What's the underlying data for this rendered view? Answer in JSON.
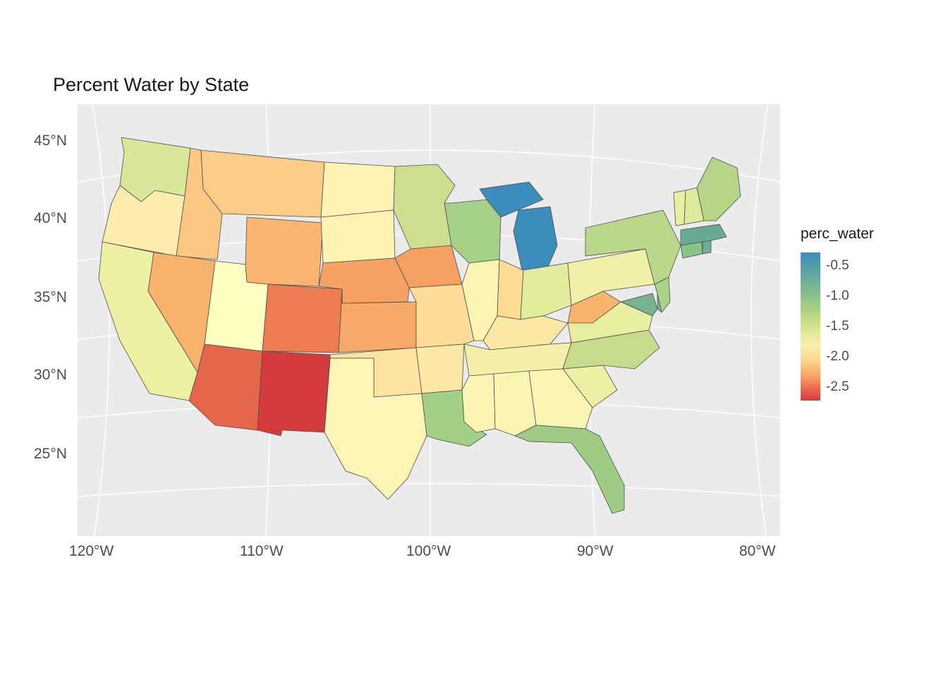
{
  "title": "Percent Water by State",
  "legend_title": "perc_water",
  "y_ticks": [
    "45°N",
    "40°N",
    "35°N",
    "30°N",
    "25°N"
  ],
  "x_ticks": [
    "120°W",
    "110°W",
    "100°W",
    "90°W",
    "80°W"
  ],
  "legend_labels": [
    "-0.5",
    "-1.0",
    "-1.5",
    "-2.0",
    "-2.5"
  ],
  "chart_data": {
    "type": "choropleth",
    "region": "US states (lower 48)",
    "title": "Percent Water by State",
    "color_scale": {
      "variable": "perc_water",
      "min": -2.7,
      "max": -0.3,
      "palette": "RdYlBu"
    },
    "xlabel": "",
    "ylabel": "",
    "x_range_deg": [
      -124,
      -67
    ],
    "y_range_deg": [
      23,
      49
    ],
    "states": [
      {
        "name": "Michigan",
        "perc_water": -0.3
      },
      {
        "name": "Massachusetts",
        "perc_water": -0.6
      },
      {
        "name": "Rhode Island",
        "perc_water": -0.6
      },
      {
        "name": "Maryland",
        "perc_water": -0.7
      },
      {
        "name": "Delaware",
        "perc_water": -0.7
      },
      {
        "name": "Florida",
        "perc_water": -0.9
      },
      {
        "name": "Louisiana",
        "perc_water": -0.9
      },
      {
        "name": "Wisconsin",
        "perc_water": -0.9
      },
      {
        "name": "New Jersey",
        "perc_water": -0.9
      },
      {
        "name": "Connecticut",
        "perc_water": -0.9
      },
      {
        "name": "Maine",
        "perc_water": -1.0
      },
      {
        "name": "Minnesota",
        "perc_water": -1.0
      },
      {
        "name": "New York",
        "perc_water": -1.0
      },
      {
        "name": "North Carolina",
        "perc_water": -1.1
      },
      {
        "name": "New Hampshire",
        "perc_water": -1.2
      },
      {
        "name": "Vermont",
        "perc_water": -1.2
      },
      {
        "name": "Virginia",
        "perc_water": -1.2
      },
      {
        "name": "Ohio",
        "perc_water": -1.2
      },
      {
        "name": "Washington",
        "perc_water": -1.2
      },
      {
        "name": "South Carolina",
        "perc_water": -1.3
      },
      {
        "name": "California",
        "perc_water": -1.3
      },
      {
        "name": "Pennsylvania",
        "perc_water": -1.3
      },
      {
        "name": "Utah",
        "perc_water": -1.4
      },
      {
        "name": "Illinois",
        "perc_water": -1.4
      },
      {
        "name": "Alabama",
        "perc_water": -1.4
      },
      {
        "name": "Mississippi",
        "perc_water": -1.4
      },
      {
        "name": "Georgia",
        "perc_water": -1.4
      },
      {
        "name": "Tennessee",
        "perc_water": -1.4
      },
      {
        "name": "Kentucky",
        "perc_water": -1.4
      },
      {
        "name": "Texas",
        "perc_water": -1.5
      },
      {
        "name": "Arkansas",
        "perc_water": -1.5
      },
      {
        "name": "Oklahoma",
        "perc_water": -1.5
      },
      {
        "name": "North Dakota",
        "perc_water": -1.5
      },
      {
        "name": "South Dakota",
        "perc_water": -1.5
      },
      {
        "name": "Oregon",
        "perc_water": -1.6
      },
      {
        "name": "Missouri",
        "perc_water": -1.6
      },
      {
        "name": "Indiana",
        "perc_water": -1.6
      },
      {
        "name": "Idaho",
        "perc_water": -1.8
      },
      {
        "name": "Montana",
        "perc_water": -1.8
      },
      {
        "name": "West Virginia",
        "perc_water": -1.9
      },
      {
        "name": "Wyoming",
        "perc_water": -1.9
      },
      {
        "name": "Nevada",
        "perc_water": -1.9
      },
      {
        "name": "Iowa",
        "perc_water": -2.0
      },
      {
        "name": "Nebraska",
        "perc_water": -2.0
      },
      {
        "name": "Kansas",
        "perc_water": -2.0
      },
      {
        "name": "Colorado",
        "perc_water": -2.2
      },
      {
        "name": "Arizona",
        "perc_water": -2.4
      },
      {
        "name": "New Mexico",
        "perc_water": -2.7
      }
    ]
  }
}
